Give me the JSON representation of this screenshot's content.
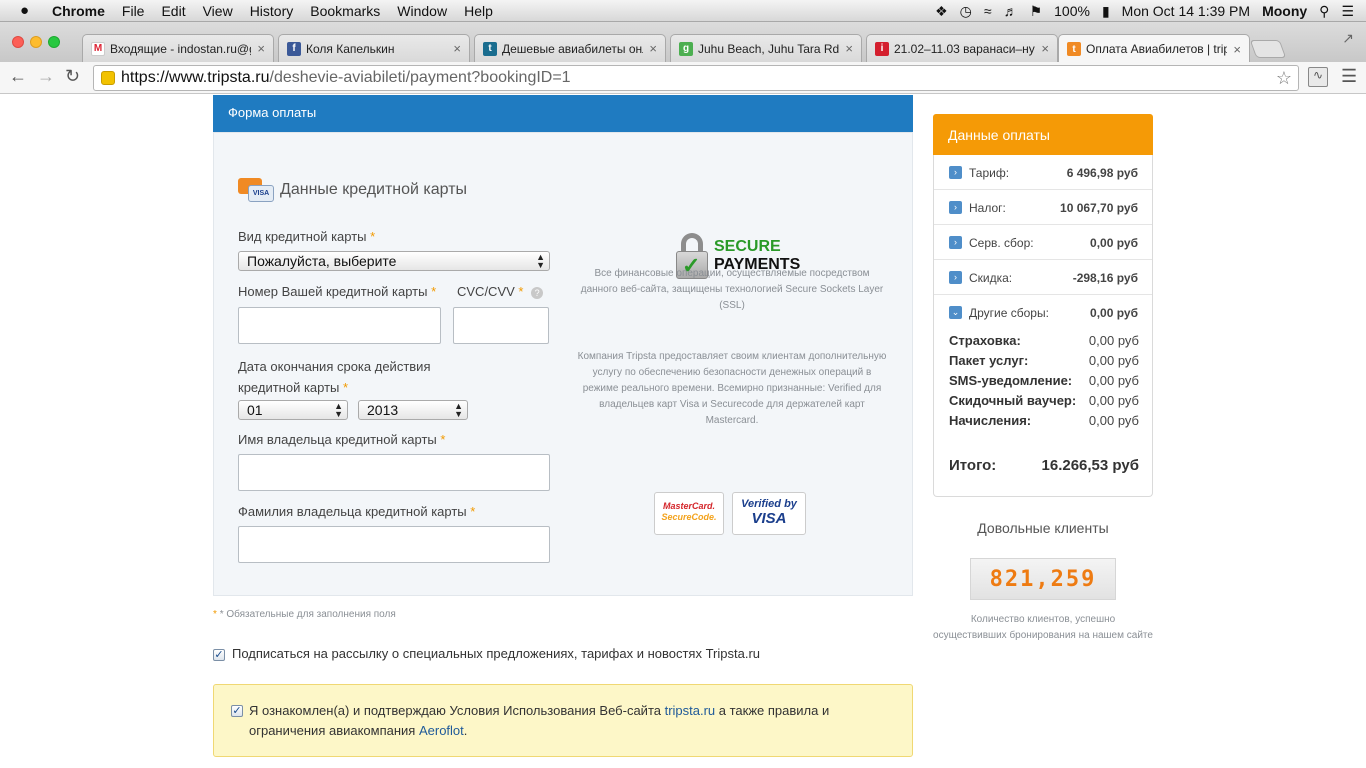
{
  "menubar": {
    "apple": "",
    "app": "Chrome",
    "items": [
      "File",
      "Edit",
      "View",
      "History",
      "Bookmarks",
      "Window",
      "Help"
    ],
    "battery": "100%",
    "clock": "Mon Oct 14  1:39 PM",
    "user": "Moony"
  },
  "tabs": [
    {
      "title": "Входящие - indostan.ru@g",
      "icon": "gmail-icon"
    },
    {
      "title": "Коля Капелькин",
      "icon": "facebook-icon"
    },
    {
      "title": "Дешевые авиабилеты онл",
      "icon": "tripsta-icon"
    },
    {
      "title": "Juhu Beach, Juhu Tara Rd, J",
      "icon": "maps-icon"
    },
    {
      "title": "21.02–11.03 варанаси–ну",
      "icon": "info-icon"
    },
    {
      "title": "Оплата Авиабилетов | trip",
      "icon": "tripsta-icon"
    }
  ],
  "address": {
    "domain": "https://www.tripsta.ru",
    "path": "/deshevie-aviabileti/payment?bookingID=1"
  },
  "form": {
    "header": "Форма оплаты",
    "cc_title": "Данные кредитной карты",
    "card_type_label": "Вид кредитной карты",
    "card_type_value": "Пожалуйста, выберите",
    "card_number_label": "Номер Вашей кредитной карты",
    "cvc_label": "CVC/CVV",
    "expiry_label_1": "Дата окончания срока действия",
    "expiry_label_2": "кредитной карты",
    "expiry_month": "01",
    "expiry_year": "2013",
    "holder_name_label": "Имя владельца кредитной карты",
    "holder_surname_label": "Фамилия владельца кредитной карты",
    "required_mark": "*",
    "visa_mini": "VISA",
    "help_mark": "?"
  },
  "secure": {
    "title_1": "SECURE",
    "title_2": "PAYMENTS",
    "ssl_text": "Все финансовые операции, осуществляемые посредством данного веб-сайта, защищены технологией Secure Sockets Layer (SSL)",
    "extra_text": "Компания Tripsta предоставляет своим клиентам дополнительную услугу по обеспечению безопасности денежных операций в режиме реального времени. Всемирно признанные: Verified для владельцев карт Visa и Securecode для держателей карт Mastercard.",
    "mc_1": "MasterCard.",
    "mc_2": "SecureCode.",
    "vbv_1": "Verified by",
    "vbv_2": "VISA"
  },
  "required_note": "* Обязательные для заполнения поля",
  "subscribe_text": "Подписаться на рассылку о специальных предложениях, тарифах и новостях Tripsta.ru",
  "terms": {
    "part1": "Я ознакомлен(а) и подтверждаю Условия Использования Веб-сайта ",
    "link1": "tripsta.ru",
    "part2": " а также правила и ограничения авиакомпания ",
    "link2": "Aeroflot",
    "part3": "."
  },
  "payment": {
    "header": "Данные оплаты",
    "rows": [
      {
        "name": "Тариф:",
        "value": "6 496,98 руб"
      },
      {
        "name": "Налог:",
        "value": "10 067,70 руб"
      },
      {
        "name": "Серв. сбор:",
        "value": "0,00 руб"
      },
      {
        "name": "Скидка:",
        "value": "-298,16 руб"
      },
      {
        "name": "Другие сборы:",
        "value": "0,00 руб"
      }
    ],
    "other": [
      {
        "name": "Страховка:",
        "value": "0,00 руб"
      },
      {
        "name": "Пакет услуг:",
        "value": "0,00 руб"
      },
      {
        "name": "SMS-уведомление:",
        "value": "0,00 руб"
      },
      {
        "name": "Скидочный ваучер:",
        "value": "0,00 руб"
      },
      {
        "name": "Начисления:",
        "value": "0,00 руб"
      }
    ],
    "total_label": "Итого:",
    "total_value": "16.266,53 руб"
  },
  "clients": {
    "title": "Довольные клиенты",
    "count": "821,259",
    "note": "Количество клиентов, успешно осуществивших бронирования на нашем сайте"
  }
}
